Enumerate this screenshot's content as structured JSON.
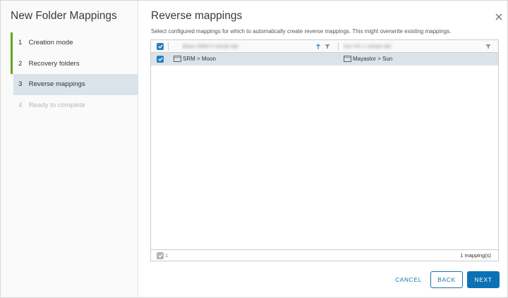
{
  "wizard": {
    "title": "New Folder Mappings",
    "steps": [
      {
        "num": "1",
        "label": "Creation mode",
        "state": "completed"
      },
      {
        "num": "2",
        "label": "Recovery folders",
        "state": "completed"
      },
      {
        "num": "3",
        "label": "Reverse mappings",
        "state": "active"
      },
      {
        "num": "4",
        "label": "Ready to complete",
        "state": "disabled"
      }
    ]
  },
  "main": {
    "title": "Reverse mappings",
    "description": "Select configured mappings for which to automatically create reverse mappings. This might overwrite existing mappings."
  },
  "grid": {
    "columns": [
      {
        "header": "Moon SRM-3 virtual site",
        "sort": "ascending",
        "filter_icon": "filter-icon"
      },
      {
        "header": "Sun VC-1 virtual site",
        "filter_icon": "filter-icon"
      }
    ],
    "rows": [
      {
        "checked": true,
        "col1": "SRM > Moon",
        "col2": "Mayastor > Sun",
        "icon": "folder-icon"
      }
    ],
    "footer": {
      "selected_count": "1",
      "total": "1 mapping(s)"
    }
  },
  "buttons": {
    "cancel": "CANCEL",
    "back": "BACK",
    "next": "NEXT"
  },
  "colors": {
    "accent": "#0b72b5",
    "progress_green": "#62a420",
    "selected_row": "#dbe3ea"
  }
}
